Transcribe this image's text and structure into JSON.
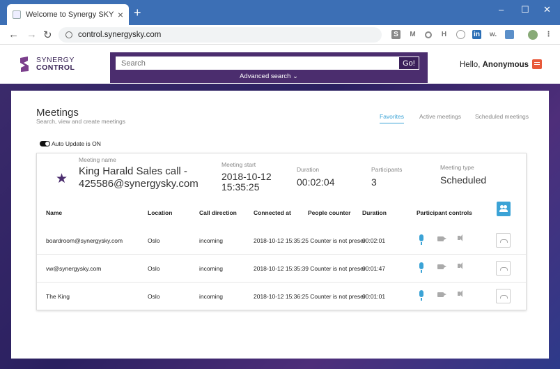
{
  "browser": {
    "tab_title": "Welcome to Synergy SKY Confer",
    "url": "control.synergysky.com"
  },
  "header": {
    "logo_line1": "SYNERGY",
    "logo_line2": "CONTROL",
    "search_placeholder": "Search",
    "go_label": "Go!",
    "advanced_search": "Advanced search",
    "greeting": "Hello,",
    "username": "Anonymous"
  },
  "page": {
    "title": "Meetings",
    "subtitle": "Search, view and create meetings",
    "tabs": [
      "Favorites",
      "Active meetings",
      "Scheduled meetings"
    ],
    "auto_update": "Auto Update is ON"
  },
  "meeting": {
    "name_label": "Meeting name",
    "name_line1": "King Harald Sales call -",
    "name_line2": "425586@synergysky.com",
    "start_label": "Meeting start",
    "start_date": "2018-10-12",
    "start_time": "15:35:25",
    "duration_label": "Duration",
    "duration": "00:02:04",
    "participants_label": "Participants",
    "participants": "3",
    "type_label": "Meeting type",
    "type": "Scheduled"
  },
  "table": {
    "headers": [
      "Name",
      "Location",
      "Call direction",
      "Connected at",
      "People counter",
      "Duration",
      "Participant controls"
    ],
    "rows": [
      {
        "name": "boardroom@synergysky.com",
        "location": "Oslo",
        "direction": "incoming",
        "connected_counter": "2018-10-12 15:35:25 Counter is not preser",
        "duration": "00:02:01"
      },
      {
        "name": "vw@synergysky.com",
        "location": "Oslo",
        "direction": "incoming",
        "connected_counter": "2018-10-12 15:35:39 Counter is not preser",
        "duration": "00:01:47"
      },
      {
        "name": "The King",
        "location": "Oslo",
        "direction": "incoming",
        "connected_counter": "2018-10-12 15:36:25 Counter is not preser",
        "duration": "00:01:01"
      }
    ]
  }
}
